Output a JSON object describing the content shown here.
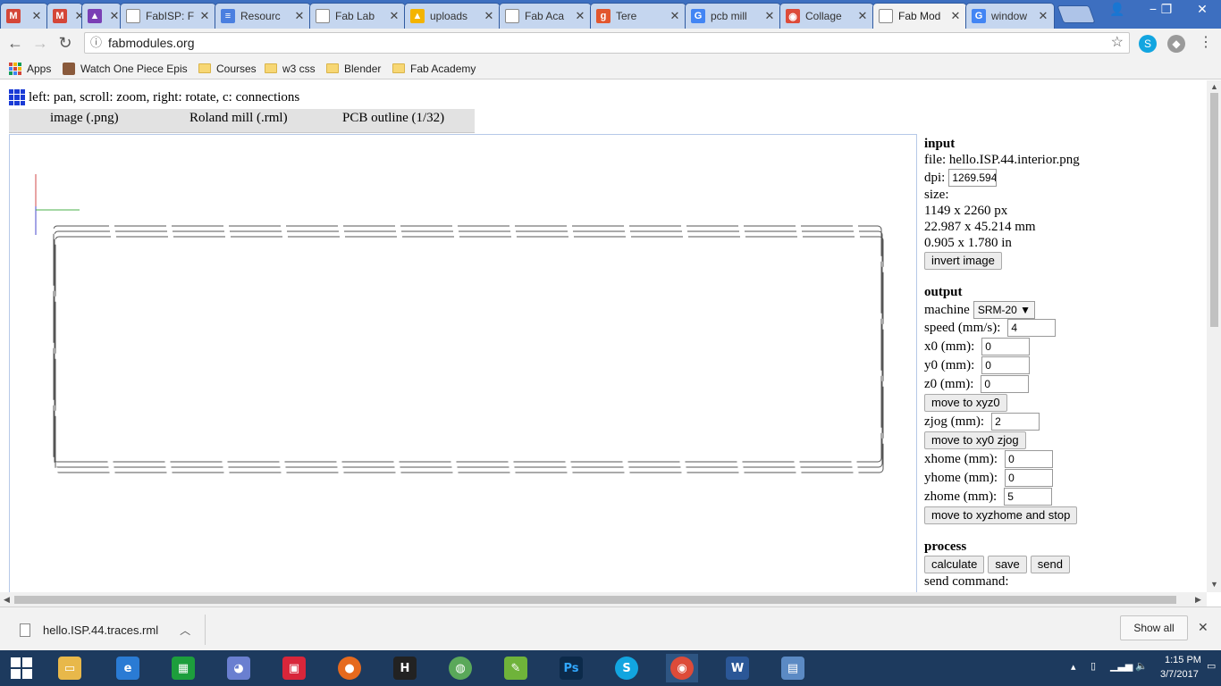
{
  "browser": {
    "tabs": [
      {
        "label": "",
        "icon": "gmail-icon",
        "color": "#d44638",
        "glyph": "M"
      },
      {
        "label": "",
        "icon": "gmail-icon",
        "color": "#d44638",
        "glyph": "M"
      },
      {
        "label": "",
        "icon": "app-icon",
        "color": "#7a3fb5",
        "glyph": "▲"
      },
      {
        "label": "FabISP: F",
        "icon": "page-icon",
        "color": "#ffffff",
        "glyph": ""
      },
      {
        "label": "Resourc",
        "icon": "docs-icon",
        "color": "#4a7fe0",
        "glyph": "≡"
      },
      {
        "label": "Fab Lab",
        "icon": "page-icon",
        "color": "#ffffff",
        "glyph": ""
      },
      {
        "label": "uploads",
        "icon": "drive-icon",
        "color": "#f4b400",
        "glyph": "▲"
      },
      {
        "label": "Fab Aca",
        "icon": "page-icon",
        "color": "#ffffff",
        "glyph": ""
      },
      {
        "label": "Tere",
        "icon": "g-icon",
        "color": "#e2572e",
        "glyph": "g"
      },
      {
        "label": "pcb mill",
        "icon": "google-icon",
        "color": "#4285f4",
        "glyph": "G"
      },
      {
        "label": "Collage",
        "icon": "chrome-icon",
        "color": "#dd4b39",
        "glyph": "◉"
      },
      {
        "label": "Fab Mod",
        "icon": "page-icon",
        "color": "#ffffff",
        "glyph": ""
      },
      {
        "label": "window",
        "icon": "google-icon",
        "color": "#4285f4",
        "glyph": "G"
      }
    ],
    "close_glyph": "✕",
    "url": "fabmodules.org",
    "bookmarks": [
      {
        "label": "Apps",
        "type": "apps"
      },
      {
        "label": "Watch One Piece Epis",
        "type": "site"
      },
      {
        "label": "Courses",
        "type": "folder"
      },
      {
        "label": "w3 css",
        "type": "site"
      },
      {
        "label": "Blender",
        "type": "folder"
      },
      {
        "label": "Fab Academy",
        "type": "folder"
      }
    ]
  },
  "page": {
    "hint": "left: pan, scroll: zoom, right: rotate, c: connections",
    "tabs": [
      "image (.png)",
      "Roland mill (.rml)",
      "PCB outline (1/32)"
    ],
    "panel": {
      "input_heading": "input",
      "file_label": "file: hello.ISP.44.interior.png",
      "dpi_label": "dpi:",
      "dpi_value": "1269.594",
      "size_label": "size:",
      "size_px": "1149 x 2260 px",
      "size_mm": "22.987 x 45.214 mm",
      "size_in": "0.905 x 1.780 in",
      "invert_button": "invert image",
      "output_heading": "output",
      "machine_label": "machine",
      "machine_value": "SRM-20",
      "speed_label": "speed (mm/s):",
      "speed_value": "4",
      "x0_label": "x0 (mm):",
      "x0_value": "0",
      "y0_label": "y0 (mm):",
      "y0_value": "0",
      "z0_label": "z0 (mm):",
      "z0_value": "0",
      "move_xyz0_button": "move to xyz0",
      "zjog_label": "zjog (mm):",
      "zjog_value": "2",
      "move_xy0_button": "move to xy0 zjog",
      "xhome_label": "xhome (mm):",
      "xhome_value": "0",
      "yhome_label": "yhome (mm):",
      "yhome_value": "0",
      "zhome_label": "zhome (mm):",
      "zhome_value": "5",
      "move_home_button": "move to xyzhome and stop",
      "process_heading": "process",
      "calculate_button": "calculate",
      "save_button": "save",
      "send_button": "send",
      "send_command_label": "send command:"
    }
  },
  "downloads": {
    "file": "hello.ISP.44.traces.rml",
    "show_all": "Show all"
  },
  "taskbar": {
    "time": "1:15 PM",
    "date": "3/7/2017"
  }
}
